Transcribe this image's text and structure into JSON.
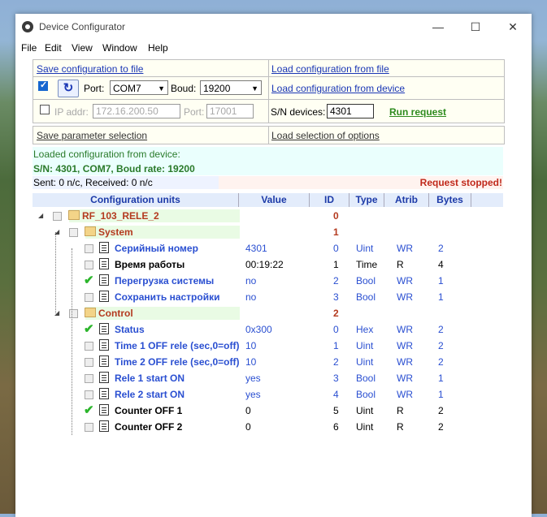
{
  "window": {
    "title": "Device Configurator",
    "min": "—",
    "max": "☐",
    "close": "✕"
  },
  "menu": [
    "File",
    "Edit",
    "View",
    "Window",
    "Help"
  ],
  "toolbar": {
    "save_config": "Save configuration to file",
    "load_config_file": "Load configuration from file",
    "port_label": "Port:",
    "port_value": "COM7",
    "baud_label": "Boud:",
    "baud_value": "19200",
    "load_config_device": "Load configuration from device",
    "ip_label": "IP addr:",
    "ip_value": "172.16.200.50",
    "ipport_label": "Port:",
    "ipport_value": "17001",
    "sn_label": "S/N devices:",
    "sn_value": "4301",
    "run_request": "Run request",
    "save_param": "Save parameter selection",
    "load_selection": "Load selection of options"
  },
  "status": {
    "line1": "Loaded configuration from device:",
    "line2": "S/N: 4301, COM7, Boud rate: 19200",
    "sent": "Sent: 0  n/c, Received: 0  n/c",
    "request": "Request stopped!"
  },
  "table": {
    "headers": [
      "Configuration units",
      "Value",
      "ID",
      "Type",
      "Atrib",
      "Bytes"
    ],
    "root": {
      "name": "RF_103_RELE_2",
      "id": "0"
    },
    "groups": [
      {
        "name": "System",
        "id": "1",
        "rows": [
          {
            "name": "Серийный номер",
            "value": "4301",
            "id": "0",
            "type": "Uint",
            "atrib": "WR",
            "bytes": "2",
            "checked": false,
            "style": "blue"
          },
          {
            "name": "Время работы",
            "value": "00:19:22",
            "id": "1",
            "type": "Time",
            "atrib": "R",
            "bytes": "4",
            "checked": false,
            "style": "dark"
          },
          {
            "name": "Перегрузка системы",
            "value": "no",
            "id": "2",
            "type": "Bool",
            "atrib": "WR",
            "bytes": "1",
            "checked": true,
            "style": "blue"
          },
          {
            "name": "Сохранить настройки",
            "value": "no",
            "id": "3",
            "type": "Bool",
            "atrib": "WR",
            "bytes": "1",
            "checked": false,
            "style": "blue"
          }
        ]
      },
      {
        "name": "Control",
        "id": "2",
        "rows": [
          {
            "name": "Status",
            "value": "0x300",
            "id": "0",
            "type": "Hex",
            "atrib": "WR",
            "bytes": "2",
            "checked": true,
            "style": "blue"
          },
          {
            "name": "Time 1 OFF rele (sec,0=off)",
            "value": "10",
            "id": "1",
            "type": "Uint",
            "atrib": "WR",
            "bytes": "2",
            "checked": false,
            "style": "blue"
          },
          {
            "name": "Time 2 OFF rele (sec,0=off)",
            "value": "10",
            "id": "2",
            "type": "Uint",
            "atrib": "WR",
            "bytes": "2",
            "checked": false,
            "style": "blue"
          },
          {
            "name": "Rele 1 start ON",
            "value": "yes",
            "id": "3",
            "type": "Bool",
            "atrib": "WR",
            "bytes": "1",
            "checked": false,
            "style": "blue"
          },
          {
            "name": "Rele 2 start ON",
            "value": "yes",
            "id": "4",
            "type": "Bool",
            "atrib": "WR",
            "bytes": "1",
            "checked": false,
            "style": "blue"
          },
          {
            "name": "Counter OFF 1",
            "value": "0",
            "id": "5",
            "type": "Uint",
            "atrib": "R",
            "bytes": "2",
            "checked": true,
            "style": "dark"
          },
          {
            "name": "Counter OFF 2",
            "value": "0",
            "id": "6",
            "type": "Uint",
            "atrib": "R",
            "bytes": "2",
            "checked": false,
            "style": "dark"
          }
        ]
      }
    ]
  }
}
